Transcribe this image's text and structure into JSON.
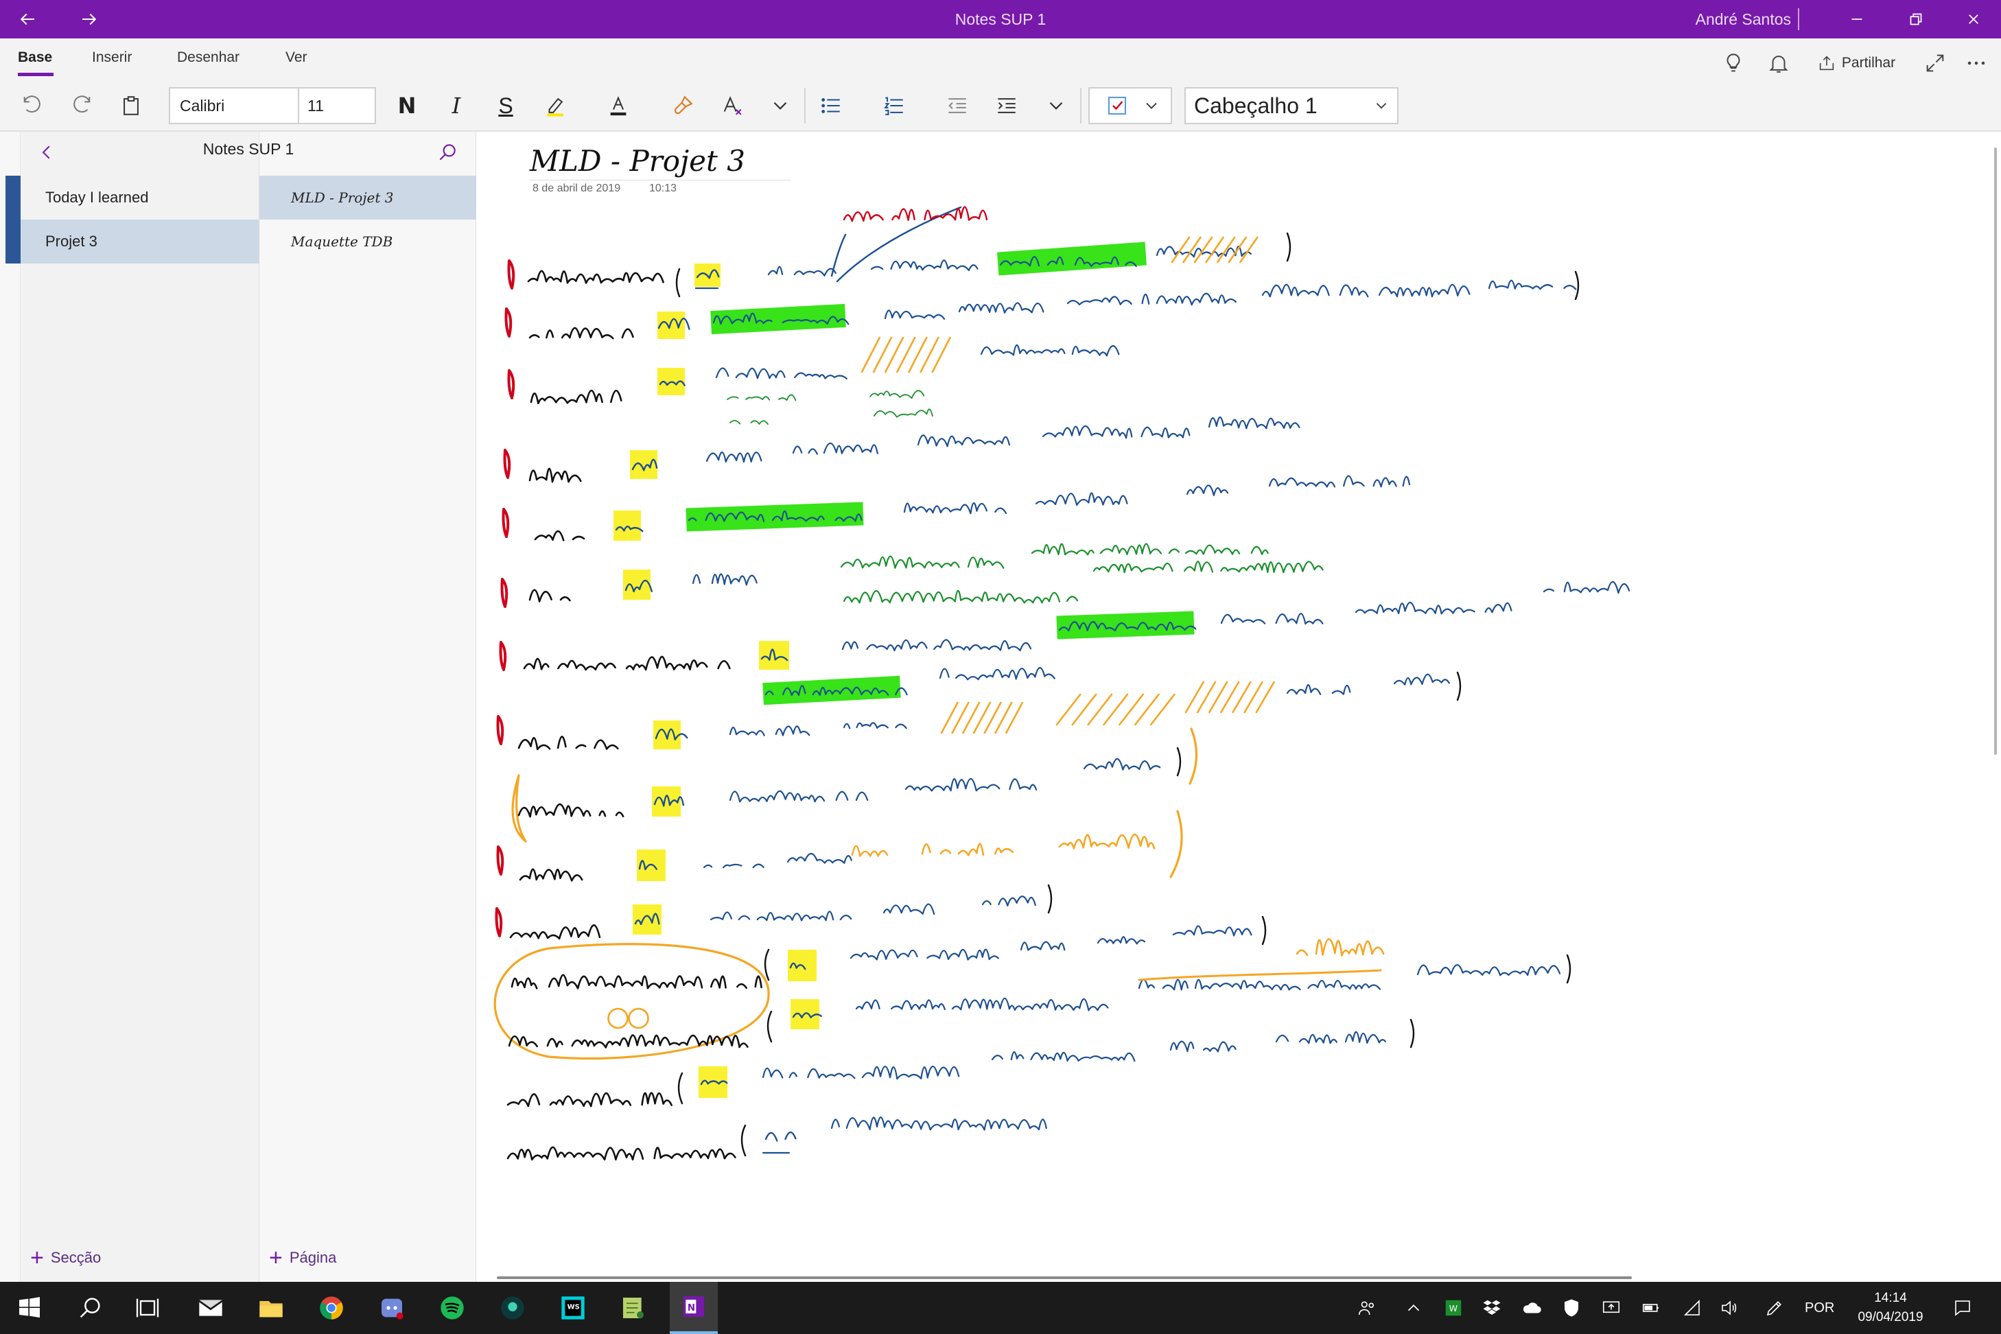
{
  "titlebar": {
    "app_title": "Notes SUP 1",
    "user_name": "André Santos"
  },
  "ribbon": {
    "tabs": [
      "Base",
      "Inserir",
      "Desenhar",
      "Ver"
    ],
    "active_tab": "Base",
    "share_label": "Partilhar"
  },
  "toolbar": {
    "font_name": "Calibri",
    "font_size": "11",
    "bold_glyph": "N",
    "italic_glyph": "I",
    "strike_glyph": "S",
    "style_value": "Cabeçalho 1",
    "highlight_color": "#ffe600",
    "font_color": "#222222"
  },
  "navigation": {
    "notebook_title": "Notes SUP 1",
    "sections": [
      {
        "label": "Today I learned",
        "selected": false
      },
      {
        "label": "Projet 3",
        "selected": true
      }
    ],
    "pages": [
      {
        "label": "MLD - Projet 3",
        "selected": true
      },
      {
        "label": "Maquette TDB",
        "selected": false
      }
    ],
    "add_section_label": "Secção",
    "add_page_label": "Página"
  },
  "page": {
    "title": "MLD - Projet 3",
    "date": "8 de abril de 2019",
    "time": "10:13"
  },
  "ink_colors": {
    "black": "#111111",
    "blue": "#1d4f91",
    "green": "#1a8f2c",
    "orange": "#f5a623",
    "red": "#d0021b",
    "highlight_green": "#22e000",
    "highlight_yellow": "#f8f01a"
  },
  "taskbar": {
    "language": "POR",
    "time": "14:14",
    "date": "09/04/2019"
  }
}
